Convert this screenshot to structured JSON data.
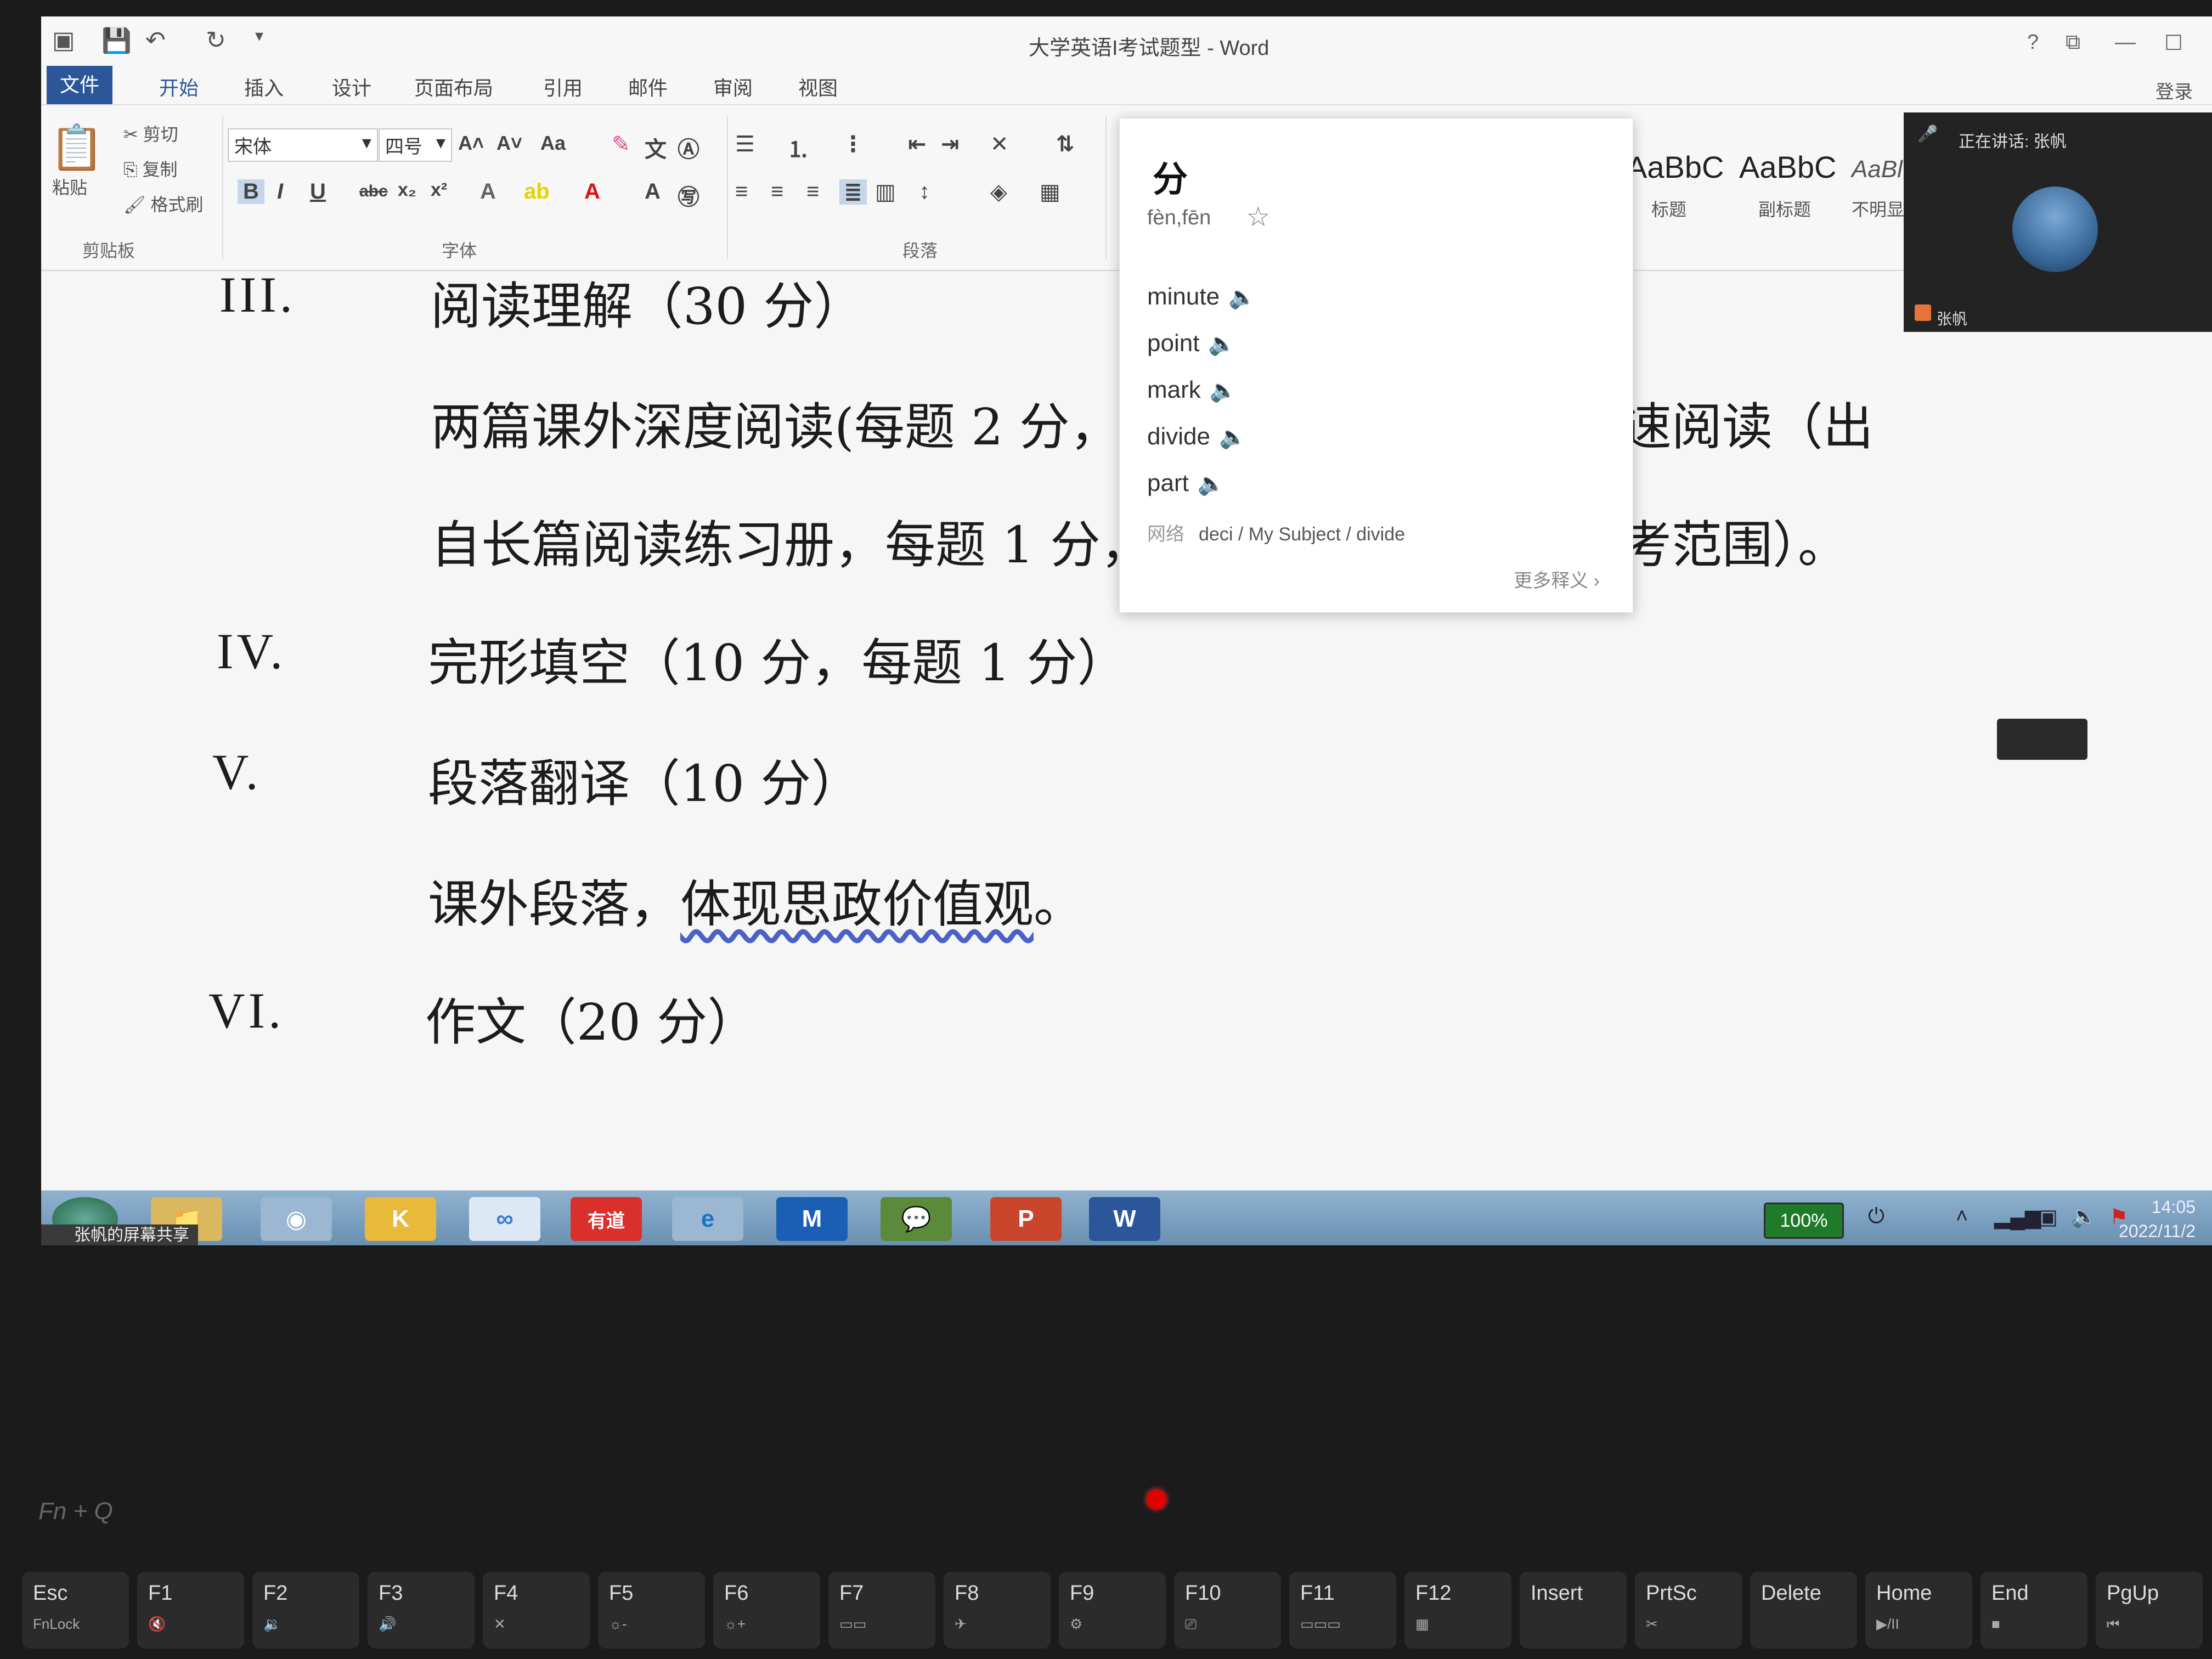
{
  "window": {
    "title": "大学英语I考试题型 - Word",
    "help": "?",
    "minimize": "—",
    "maximize": "☐",
    "login": "登录"
  },
  "tabs": [
    "文件",
    "开始",
    "插入",
    "设计",
    "页面布局",
    "引用",
    "邮件",
    "审阅",
    "视图"
  ],
  "ribbon": {
    "clipboard": {
      "paste": "粘贴",
      "cut": "剪切",
      "copy": "复制",
      "format_painter": "格式刷",
      "group": "剪贴板"
    },
    "font": {
      "name": "宋体",
      "size": "四号",
      "group": "字体",
      "bold": "B",
      "italic": "I",
      "underline": "U",
      "strike": "abc",
      "sub": "x₂",
      "sup": "x²",
      "grow": "A˄",
      "shrink": "A˅",
      "case": "Aa"
    },
    "paragraph": {
      "group": "段落"
    },
    "styles": [
      {
        "sample": "AaBbC",
        "name": "标题"
      },
      {
        "sample": "AaBbC",
        "name": "副标题"
      },
      {
        "sample": "AaBl",
        "name": "不明显"
      }
    ]
  },
  "document": {
    "sections": [
      {
        "num": "III.",
        "text": "阅读理解（30 分）"
      },
      {
        "num": "",
        "text": "两篇课外深度阅读(每题 2 分，"
      },
      {
        "num": "",
        "text": "自长篇阅读练习册，每题 1 分，"
      },
      {
        "num": "IV.",
        "text": "完形填空（10 分，每题 1 分）"
      },
      {
        "num": "V.",
        "text": "段落翻译（10 分）"
      },
      {
        "num": "",
        "text_a": "课外段落，",
        "text_b": "体现思政价值观",
        "text_c": "。"
      },
      {
        "num": "VI.",
        "text": "作文（20 分）"
      }
    ],
    "right_frag_1": "速阅读（出",
    "right_frag_2": "考范围）。"
  },
  "dictionary": {
    "word": "分",
    "pinyin": "fèn,fēn",
    "meanings": [
      "minute",
      "point",
      "mark",
      "divide",
      "part"
    ],
    "web_label": "网络",
    "web_text": "deci / My Subject / divide",
    "more": "更多释义 ›"
  },
  "meeting": {
    "speaking": "正在讲话: 张帆",
    "participant": "张帆"
  },
  "taskbar": {
    "share_label": "张帆的屏幕共享",
    "battery": "100%",
    "time": "14:05",
    "date": "2022/11/2",
    "apps": [
      "folder",
      "chrome",
      "kugou",
      "baidu-netdisk",
      "youdao",
      "ie",
      "lark",
      "wechat",
      "powerpoint",
      "word"
    ],
    "youdao_label": "有道",
    "ppt_label": "P",
    "word_label": "W"
  },
  "keyboard": {
    "combo": "Fn + Q",
    "keys": [
      {
        "label": "Esc",
        "sub": "FnLock"
      },
      {
        "label": "F1",
        "sub": "🔇"
      },
      {
        "label": "F2",
        "sub": "🔉"
      },
      {
        "label": "F3",
        "sub": "🔊"
      },
      {
        "label": "F4",
        "sub": "✕"
      },
      {
        "label": "F5",
        "sub": "☼-"
      },
      {
        "label": "F6",
        "sub": "☼+"
      },
      {
        "label": "F7",
        "sub": "▭▭"
      },
      {
        "label": "F8",
        "sub": "✈"
      },
      {
        "label": "F9",
        "sub": "⚙"
      },
      {
        "label": "F10",
        "sub": "⎚"
      },
      {
        "label": "F11",
        "sub": "▭▭▭"
      },
      {
        "label": "F12",
        "sub": "▦"
      },
      {
        "label": "Insert",
        "sub": ""
      },
      {
        "label": "PrtSc",
        "sub": "✂"
      },
      {
        "label": "Delete",
        "sub": ""
      },
      {
        "label": "Home",
        "sub": "▶/II"
      },
      {
        "label": "End",
        "sub": "■"
      },
      {
        "label": "PgUp",
        "sub": "⏮"
      }
    ]
  },
  "colors": {
    "accent": "#2b579a",
    "taskbar": "#7a9ec0",
    "speaker_icon": "#e25d5d",
    "power_led": "#e00000"
  }
}
